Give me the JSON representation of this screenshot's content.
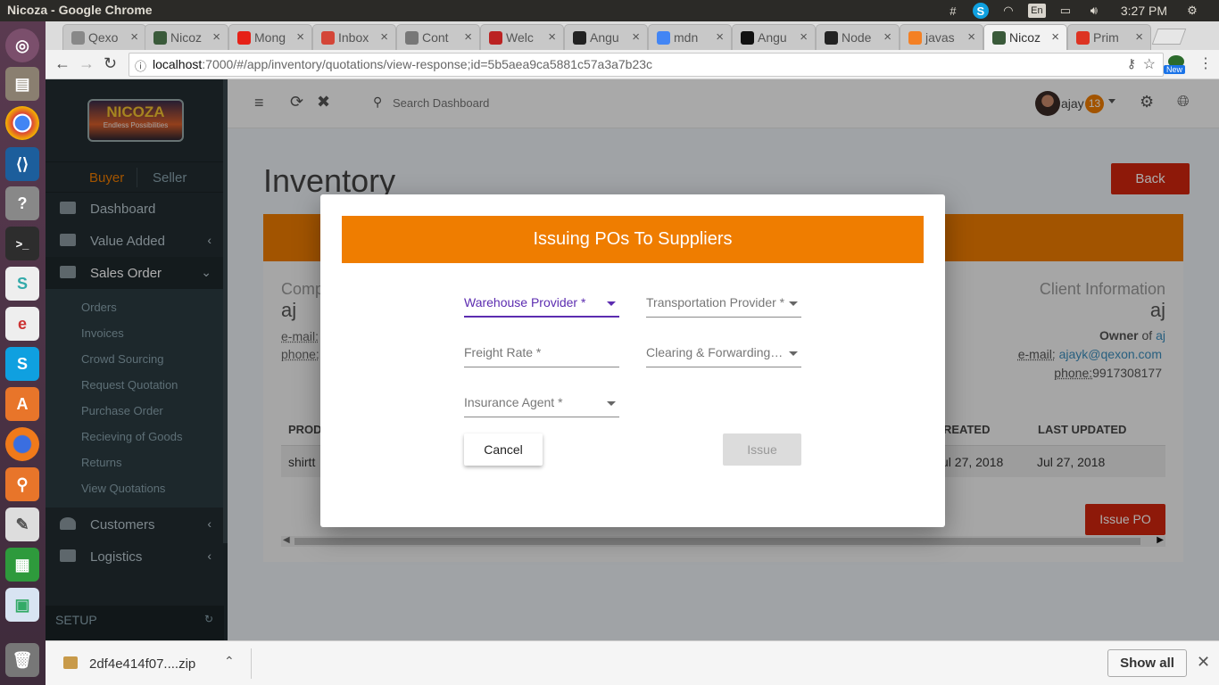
{
  "os": {
    "window_title": "Nicoza - Google Chrome",
    "lang": "En",
    "clock": "3:27 PM"
  },
  "browser": {
    "tabs": [
      {
        "label": "Qexo",
        "color": "#888"
      },
      {
        "label": "Nicoz",
        "color": "#3a5a3a"
      },
      {
        "label": "Mong",
        "color": "#e62117"
      },
      {
        "label": "Inbox",
        "color": "#d44638"
      },
      {
        "label": "Cont",
        "color": "#777"
      },
      {
        "label": "Welc",
        "color": "#b22"
      },
      {
        "label": "Angu",
        "color": "#222"
      },
      {
        "label": "mdn",
        "color": "#4285f4"
      },
      {
        "label": "Angu",
        "color": "#111"
      },
      {
        "label": "Node",
        "color": "#222"
      },
      {
        "label": "javas",
        "color": "#f48024"
      },
      {
        "label": "Nicoz",
        "color": "#3a5a3a"
      },
      {
        "label": "Prim",
        "color": "#d32"
      }
    ],
    "url_host": "localhost",
    "url_path": ":7000/#/app/inventory/quotations/view-response;id=5b5aea9ca5881c57a3a7b23c",
    "new_badge": "New"
  },
  "sidebar": {
    "logo_text": "NICOZA",
    "logo_tagline": "Endless Possibilities",
    "role_buyer": "Buyer",
    "role_seller": "Seller",
    "items": [
      {
        "label": "Dashboard"
      },
      {
        "label": "Value Added"
      },
      {
        "label": "Sales Order"
      }
    ],
    "sub_items": [
      {
        "label": "Orders"
      },
      {
        "label": "Invoices"
      },
      {
        "label": "Crowd Sourcing"
      },
      {
        "label": "Request Quotation"
      },
      {
        "label": "Purchase Order"
      },
      {
        "label": "Recieving of Goods"
      },
      {
        "label": "Returns"
      },
      {
        "label": "View Quotations"
      }
    ],
    "customers": "Customers",
    "logistics": "Logistics",
    "setup": "SETUP"
  },
  "header": {
    "search_placeholder": "Search Dashboard",
    "user": "ajay",
    "badge": "13"
  },
  "page": {
    "title": "Inventory",
    "back": "Back",
    "company_label": "Comp",
    "company_name": "aj",
    "email_label": "e-mail:",
    "phone_label": "phone:",
    "client_label": "Client Information",
    "client_name": "aj",
    "owner_label": "Owner",
    "owner_of": "of",
    "owner_link": "aj",
    "client_email_label": "e-mail:",
    "client_email": "ajayk@qexon.com",
    "client_phone_label": "phone:",
    "client_phone": "9917308177",
    "table": {
      "col_product": "PROD",
      "col_created": "REATED",
      "col_updated": "LAST UPDATED",
      "row_product": "shirtt",
      "row_created": "ul 27, 2018",
      "row_updated": "Jul 27, 2018"
    },
    "issue_po": "Issue PO"
  },
  "modal": {
    "title": "Issuing POs To Suppliers",
    "warehouse": "Warehouse Provider *",
    "transportation": "Transportation Provider *",
    "freight": "Freight Rate *",
    "clearing": "Clearing & Forwarding Agent *",
    "insurance": "Insurance Agent *",
    "cancel": "Cancel",
    "issue": "Issue"
  },
  "downloads": {
    "file": "2df4e414f07....zip",
    "show_all": "Show all"
  }
}
